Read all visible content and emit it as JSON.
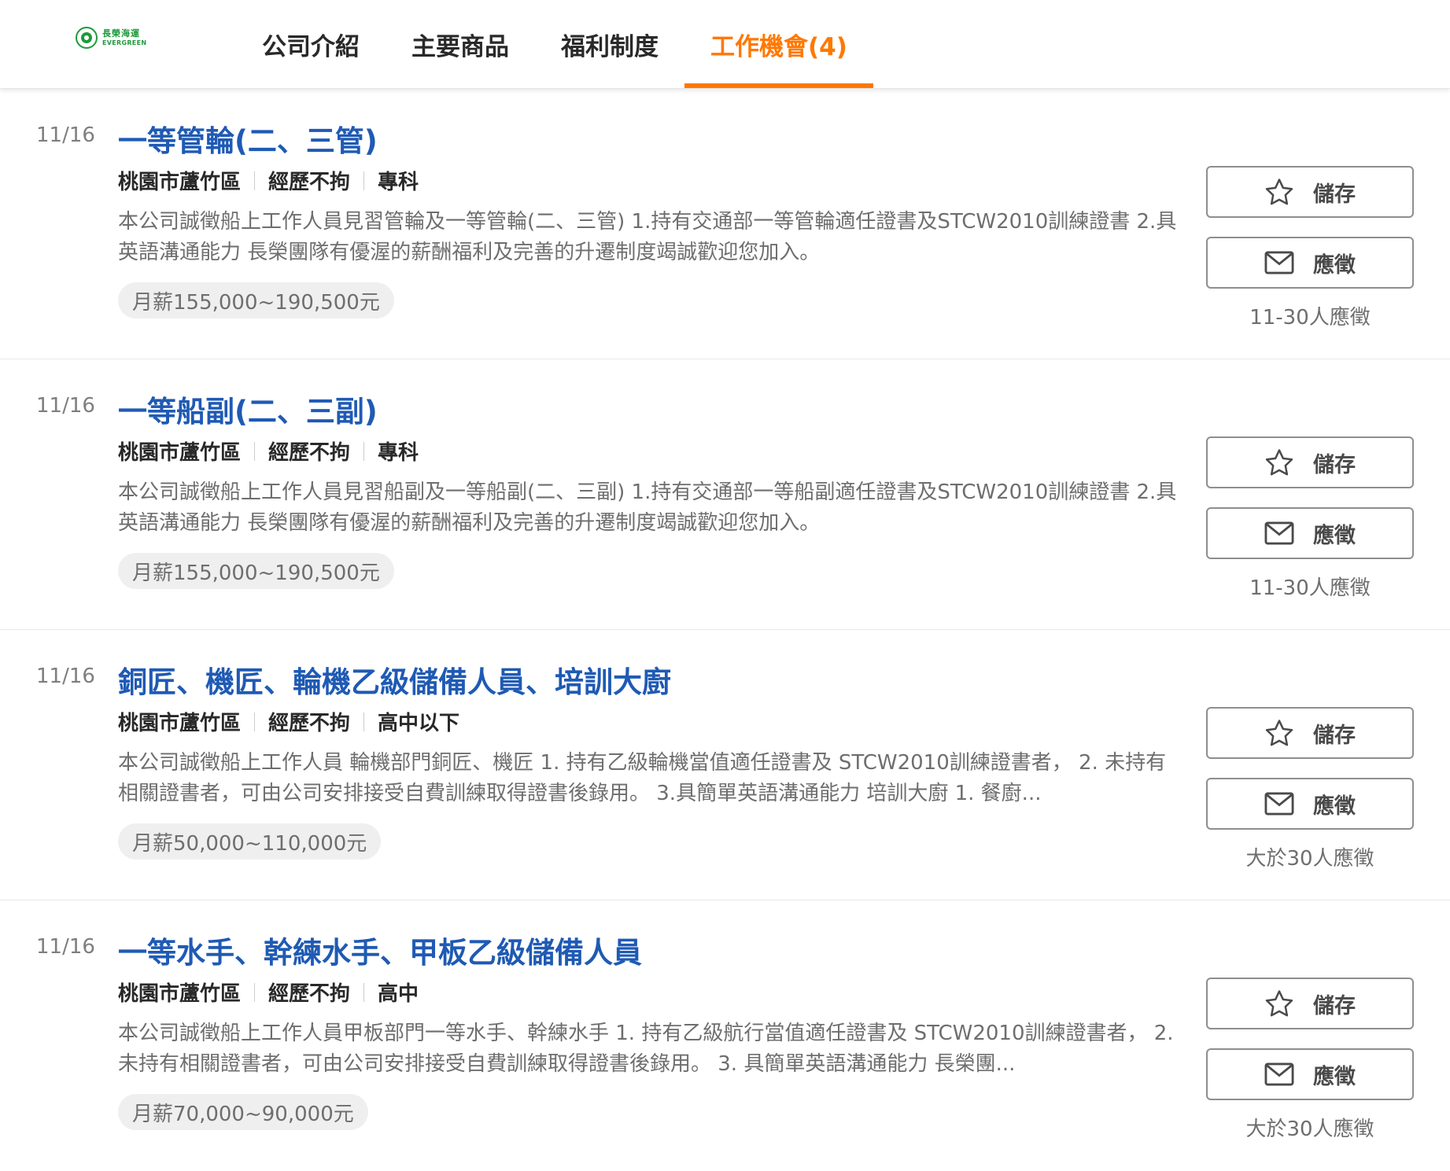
{
  "logo": {
    "cn": "長榮海運",
    "en": "EVERGREEN"
  },
  "tabs": [
    {
      "label": "公司介紹"
    },
    {
      "label": "主要商品"
    },
    {
      "label": "福利制度"
    },
    {
      "label": "工作機會(4)",
      "active": true
    }
  ],
  "colors": {
    "accent": "#ff7800",
    "title": "#1f5ab4"
  },
  "buttons": {
    "save_label": "儲存",
    "apply_label": "應徵"
  },
  "icons": {
    "save": "star-icon",
    "apply": "envelope-icon"
  },
  "jobs": [
    {
      "date": "11/16",
      "title": "一等管輪(二、三管)",
      "location": "桃園市蘆竹區",
      "experience": "經歷不拘",
      "education": "專科",
      "description": "本公司誠徵船上工作人員見習管輪及一等管輪(二、三管) 1.持有交通部一等管輪適任證書及STCW2010訓練證書 2.具英語溝通能力 長榮團隊有優渥的薪酬福利及完善的升遷制度竭誠歡迎您加入。",
      "salary": "月薪155,000~190,500元",
      "applicants": "11-30人應徵"
    },
    {
      "date": "11/16",
      "title": "一等船副(二、三副)",
      "location": "桃園市蘆竹區",
      "experience": "經歷不拘",
      "education": "專科",
      "description": "本公司誠徵船上工作人員見習船副及一等船副(二、三副) 1.持有交通部一等船副適任證書及STCW2010訓練證書 2.具英語溝通能力 長榮團隊有優渥的薪酬福利及完善的升遷制度竭誠歡迎您加入。",
      "salary": "月薪155,000~190,500元",
      "applicants": "11-30人應徵"
    },
    {
      "date": "11/16",
      "title": "銅匠、機匠、輪機乙級儲備人員、培訓大廚",
      "location": "桃園市蘆竹區",
      "experience": "經歷不拘",
      "education": "高中以下",
      "description": "本公司誠徵船上工作人員 輪機部門銅匠、機匠 1. 持有乙級輪機當值適任證書及 STCW2010訓練證書者， 2. 未持有相關證書者，可由公司安排接受自費訓練取得證書後錄用。 3.具簡單英語溝通能力 培訓大廚 1. 餐廚...",
      "salary": "月薪50,000~110,000元",
      "applicants": "大於30人應徵"
    },
    {
      "date": "11/16",
      "title": "一等水手、幹練水手、甲板乙級儲備人員",
      "location": "桃園市蘆竹區",
      "experience": "經歷不拘",
      "education": "高中",
      "description": "本公司誠徵船上工作人員甲板部門一等水手、幹練水手 1. 持有乙級航行當值適任證書及 STCW2010訓練證書者， 2. 未持有相關證書者，可由公司安排接受自費訓練取得證書後錄用。 3. 具簡單英語溝通能力 長榮團...",
      "salary": "月薪70,000~90,000元",
      "applicants": "大於30人應徵"
    }
  ]
}
